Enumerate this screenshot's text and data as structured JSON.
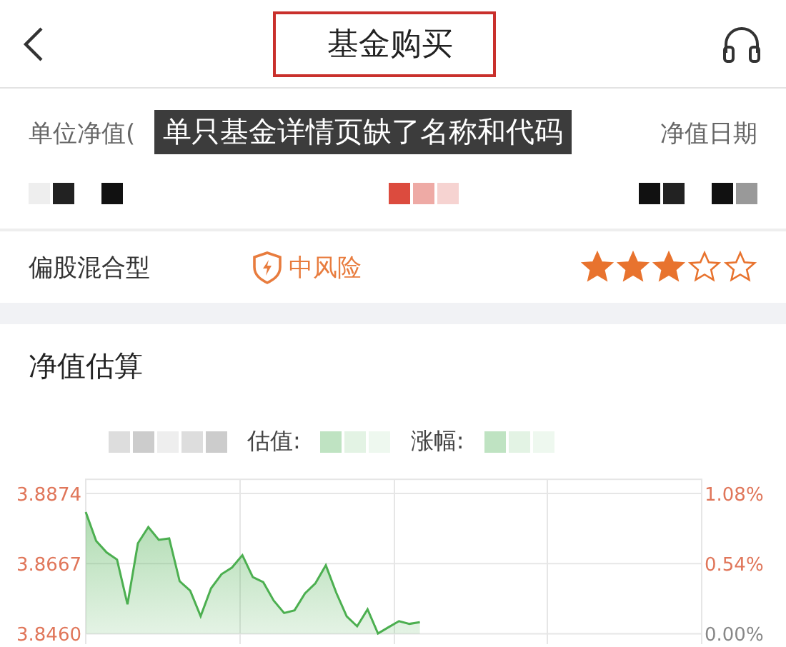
{
  "header": {
    "title": "基金购买",
    "title_highlighted": true
  },
  "annotation": "单只基金详情页缺了名称和代码",
  "summary": {
    "nav_label": "单位净值(",
    "date_label": "净值日期"
  },
  "fund": {
    "type": "偏股混合型",
    "risk": "中风险",
    "stars": 3
  },
  "estimate": {
    "title": "净值估算",
    "value_label": "估值:",
    "change_label": "涨幅:",
    "right_axis_labels": [
      "1.08%",
      "0.54%",
      "0.00%"
    ],
    "chart_data": {
      "type": "area",
      "ylim": [
        3.846,
        3.8874
      ],
      "yticks": [
        {
          "value": 3.8874,
          "label": "3.8874"
        },
        {
          "value": 3.8667,
          "label": "3.8667"
        },
        {
          "value": 3.846,
          "label": "3.8460"
        }
      ],
      "categories": [
        null,
        null,
        null,
        null,
        null,
        null,
        null,
        null,
        null,
        null,
        null,
        null,
        null,
        null,
        null,
        null,
        null,
        null,
        null,
        null,
        null,
        null,
        null,
        null,
        null,
        null,
        null,
        null,
        null,
        null,
        null,
        null,
        null
      ],
      "series": [
        {
          "color": "#4caf50",
          "values": [
            3.8819,
            3.8734,
            3.87,
            3.8679,
            3.8547,
            3.8727,
            3.8775,
            3.8737,
            3.8741,
            3.8615,
            3.8587,
            3.8512,
            3.8594,
            3.8636,
            3.8655,
            3.8692,
            3.8627,
            3.8612,
            3.8558,
            3.8521,
            3.8529,
            3.8579,
            3.8609,
            3.8662,
            3.8581,
            3.8511,
            3.8482,
            3.8532,
            3.8461,
            3.8479,
            3.8497,
            3.8489,
            3.8494
          ]
        }
      ]
    }
  }
}
